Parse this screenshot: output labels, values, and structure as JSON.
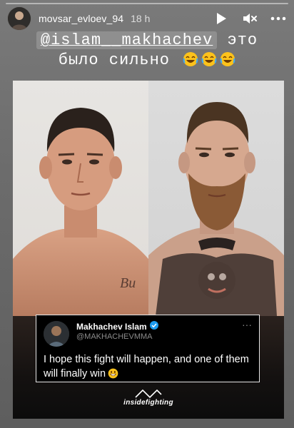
{
  "header": {
    "username": "movsar_evloev_94",
    "time": "18 h",
    "icons": [
      "play-icon",
      "mute-icon",
      "more-icon"
    ]
  },
  "story": {
    "progress": 0.0,
    "caption_mention": "@islam__makhachev",
    "caption_after_mention": "это",
    "caption_line2": "было сильно",
    "caption_emojis": [
      "laughing-tears-emoji",
      "laughing-tears-emoji",
      "laughing-tears-emoji"
    ]
  },
  "tweet": {
    "name": "Makhachev Islam",
    "handle": "@MAKHACHEVMMA",
    "text": "I hope this fight will happen, and one of them will finally win",
    "emoji": "grinning-emoji",
    "more_label": "···"
  },
  "brand": {
    "name": "insidefighting"
  },
  "colors": {
    "background": "#6f6f6f",
    "tweet_bg": "#000000",
    "verified": "#1d9bf0"
  }
}
